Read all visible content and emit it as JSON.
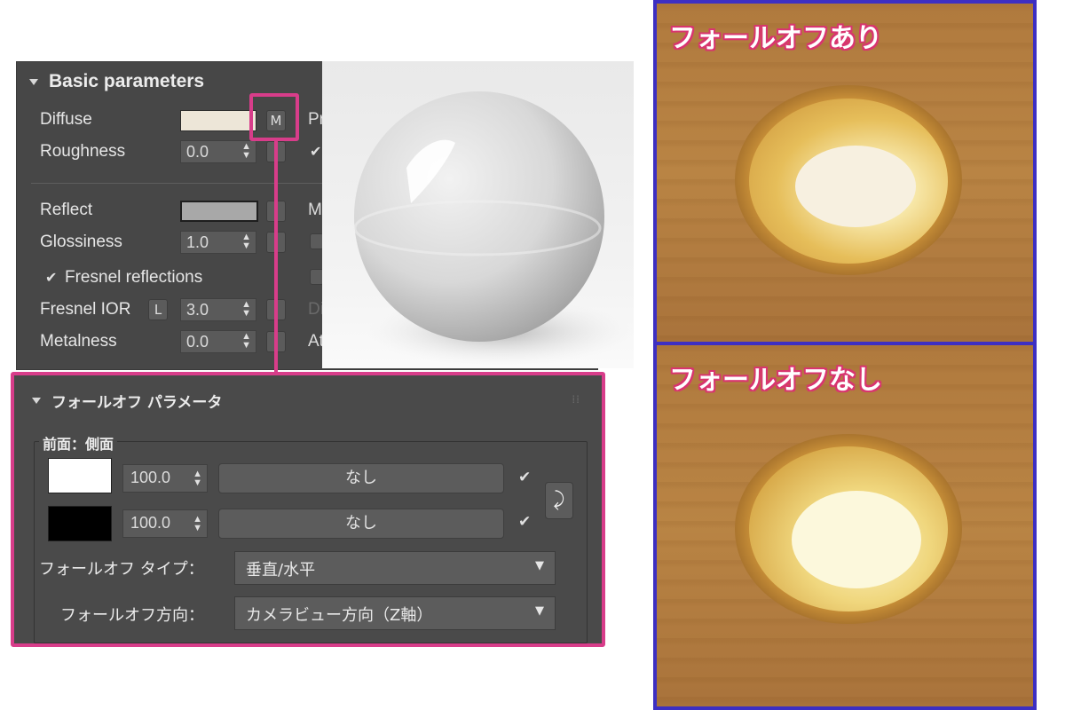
{
  "basic_panel": {
    "header": "Basic parameters",
    "diffuse_label": "Diffuse",
    "diffuse_map_button": "M",
    "roughness_label": "Roughness",
    "roughness_value": "0.0",
    "reflect_label": "Reflect",
    "glossiness_label": "Glossiness",
    "glossiness_value": "1.0",
    "fresnel_label": "Fresnel reflections",
    "fresnel_ior_label": "Fresnel IOR",
    "fresnel_lock": "L",
    "fresnel_ior_value": "3.0",
    "metalness_label": "Metalness",
    "metalness_value": "0.0",
    "cut_labels": [
      "Pr",
      "M",
      "Di",
      "At"
    ],
    "colors": {
      "diffuse": "#ede6d8",
      "reflect": "#a8a8a8"
    }
  },
  "falloff_panel": {
    "header": "フォールオフ パラメータ",
    "group_label": "前面：側面",
    "rows": [
      {
        "value": "100.0",
        "map": "なし",
        "color": "#ffffff"
      },
      {
        "value": "100.0",
        "map": "なし",
        "color": "#000000"
      }
    ],
    "swap_icon": "swap-icon",
    "type_label": "フォールオフ タイプ：",
    "type_value": "垂直/水平",
    "direction_label": "フォールオフ方向：",
    "direction_value": "カメラビュー方向（Z軸）"
  },
  "comparison": {
    "with_label": "フォールオフあり",
    "without_label": "フォールオフなし"
  },
  "accent_colors": {
    "highlight": "#d83d8a",
    "frame": "#3d2fc2"
  }
}
